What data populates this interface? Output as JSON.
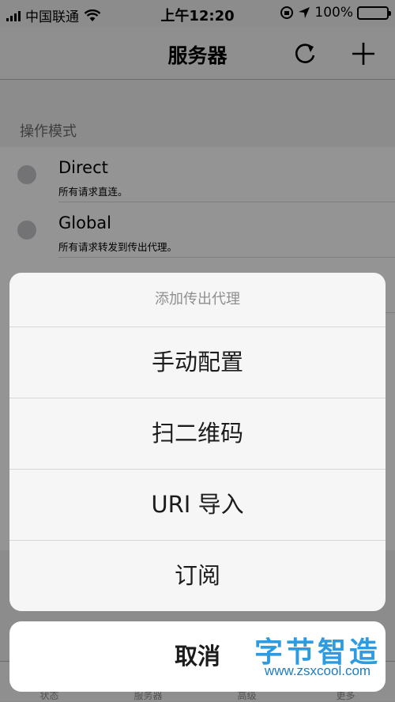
{
  "status_bar": {
    "carrier": "中国联通",
    "time": "上午12:20",
    "battery": "100%"
  },
  "nav": {
    "title": "服务器"
  },
  "mode_section": {
    "header": "操作模式",
    "items": [
      {
        "title": "Direct",
        "subtitle": "所有请求直连。"
      },
      {
        "title": "Global",
        "subtitle": "所有请求转发到传出代理。"
      }
    ]
  },
  "tabs": [
    "状态",
    "服务器",
    "高级",
    "更多"
  ],
  "action_sheet": {
    "title": "添加传出代理",
    "items": [
      "手动配置",
      "扫二维码",
      "URI 导入",
      "订阅"
    ],
    "cancel": "取消"
  },
  "watermark": {
    "logo": "字节智造",
    "url": "www.zsxcool.com"
  },
  "colors": {
    "battery_fill": "#4cd964",
    "watermark": "#2c9be0"
  }
}
